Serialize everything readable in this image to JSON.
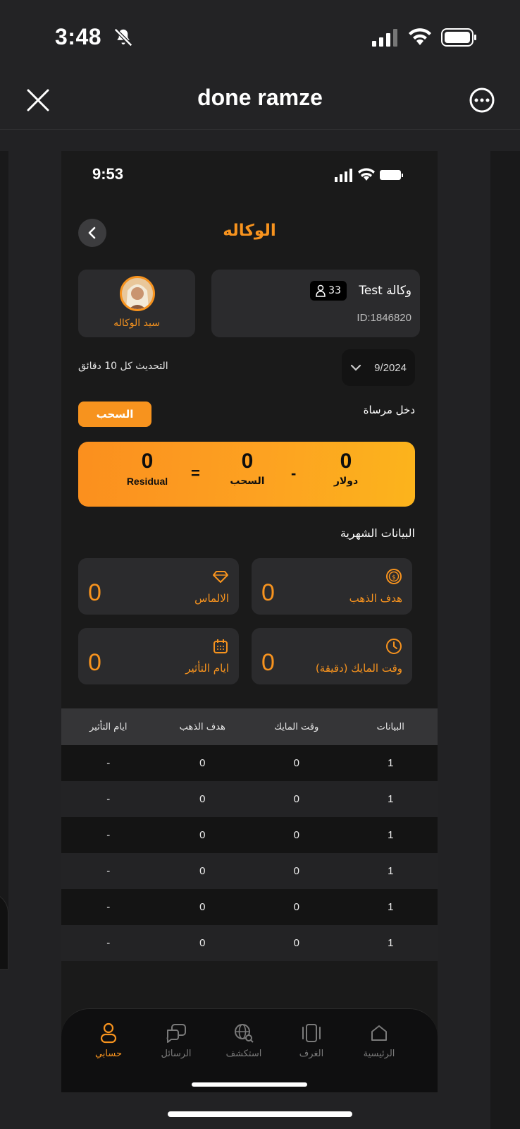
{
  "status_bar": {
    "time": "3:48"
  },
  "header": {
    "title": "done ramze"
  },
  "inner_status": {
    "time": "9:53"
  },
  "page": {
    "title": "الوكاله",
    "owner_label": "سيد الوكاله",
    "agency_name": "وكالة Test",
    "member_count": "33",
    "agency_id": "ID:1846820",
    "refresh_note": "التحديث كل 10 دقائق",
    "month": "9/2024",
    "income_label": "دخل مرساة",
    "withdraw_button": "السحب",
    "balance": {
      "dollar_value": "0",
      "dollar_label": "دولار",
      "minus": "-",
      "withdraw_value": "0",
      "withdraw_label": "السحب",
      "equals": "=",
      "residual_value": "0",
      "residual_label": "Residual"
    },
    "monthly_label": "البيانات الشهرية",
    "stats": {
      "gold_target": {
        "label": "هدف الذهب",
        "value": "0"
      },
      "diamonds": {
        "label": "الالماس",
        "value": "0"
      },
      "mic_time": {
        "label": "وقت المايك (دقيقة)",
        "value": "0"
      },
      "effect_days": {
        "label": "ايام التأثير",
        "value": "0"
      }
    },
    "table": {
      "headers": [
        "البيانات",
        "وقت المايك",
        "هدف الذهب",
        "ايام التأثير"
      ],
      "rows": [
        [
          "1",
          "0",
          "0",
          "-"
        ],
        [
          "1",
          "0",
          "0",
          "-"
        ],
        [
          "1",
          "0",
          "0",
          "-"
        ],
        [
          "1",
          "0",
          "0",
          "-"
        ],
        [
          "1",
          "0",
          "0",
          "-"
        ],
        [
          "1",
          "0",
          "0",
          "-"
        ]
      ]
    }
  },
  "tabbar": {
    "home": "الرئيسية",
    "rooms": "الغرف",
    "explore": "استكشف",
    "messages": "الرسائل",
    "account": "حسابي"
  },
  "colors": {
    "accent": "#f7931e",
    "background": "#1a1a1a",
    "card": "#2b2b2d"
  }
}
